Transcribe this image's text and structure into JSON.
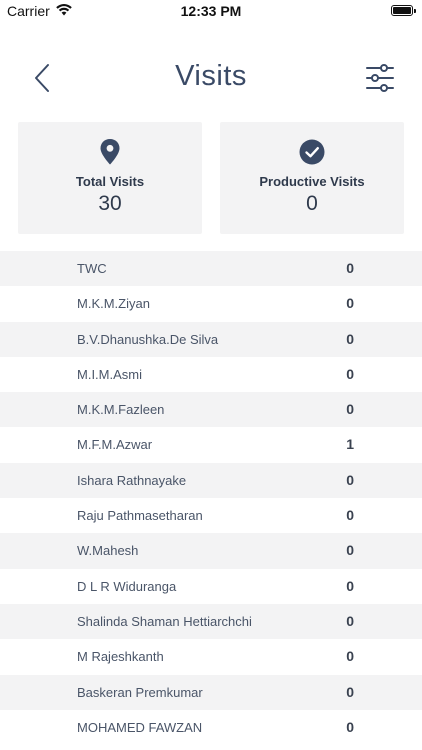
{
  "status_bar": {
    "carrier": "Carrier",
    "time": "12:33 PM"
  },
  "header": {
    "title": "Visits"
  },
  "stats": {
    "total_visits": {
      "label": "Total Visits",
      "value": "30"
    },
    "productive_visits": {
      "label": "Productive Visits",
      "value": "0"
    }
  },
  "visits": [
    {
      "name": "TWC",
      "count": "0"
    },
    {
      "name": "M.K.M.Ziyan",
      "count": "0"
    },
    {
      "name": "B.V.Dhanushka.De Silva",
      "count": "0"
    },
    {
      "name": "M.I.M.Asmi",
      "count": "0"
    },
    {
      "name": "M.K.M.Fazleen",
      "count": "0"
    },
    {
      "name": "M.F.M.Azwar",
      "count": "1"
    },
    {
      "name": "Ishara Rathnayake",
      "count": "0"
    },
    {
      "name": "Raju Pathmasetharan",
      "count": "0"
    },
    {
      "name": "W.Mahesh",
      "count": "0"
    },
    {
      "name": "D L R Widuranga",
      "count": "0"
    },
    {
      "name": "Shalinda Shaman Hettiarchchi",
      "count": "0"
    },
    {
      "name": "M Rajeshkanth",
      "count": "0"
    },
    {
      "name": "Baskeran Premkumar",
      "count": "0"
    },
    {
      "name": "MOHAMED FAWZAN",
      "count": "0"
    }
  ],
  "colors": {
    "primary": "#3a4a66",
    "card_bg": "#f3f3f4",
    "text": "#2f3a4c"
  },
  "icons": {
    "back": "chevron-left-icon",
    "filter": "sliders-icon",
    "total": "map-pin-icon",
    "productive": "check-circle-icon"
  }
}
